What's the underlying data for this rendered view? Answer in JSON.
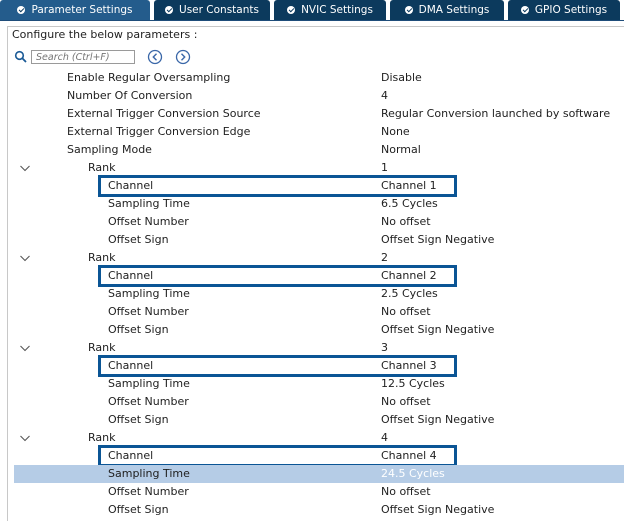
{
  "tabs": [
    {
      "label": "Parameter Settings",
      "active": true
    },
    {
      "label": "User Constants",
      "active": false
    },
    {
      "label": "NVIC Settings",
      "active": false
    },
    {
      "label": "DMA Settings",
      "active": false
    },
    {
      "label": "GPIO Settings",
      "active": false
    }
  ],
  "configure_text": "Configure the below parameters :",
  "search": {
    "placeholder": "Search (Ctrl+F)"
  },
  "colors": {
    "tab_bg": "#0c3a5d",
    "tab_active": "#245c8c",
    "highlight": "#0b5595",
    "selected_row": "#b5cce6"
  },
  "params": [
    {
      "name": "Enable Regular Oversampling",
      "value": "Disable"
    },
    {
      "name": "Number Of Conversion",
      "value": "4"
    },
    {
      "name": "External Trigger Conversion Source",
      "value": "Regular Conversion launched by software"
    },
    {
      "name": "External Trigger Conversion Edge",
      "value": "None"
    },
    {
      "name": "Sampling Mode",
      "value": "Normal"
    }
  ],
  "ranks": [
    {
      "label": "Rank",
      "value": "1",
      "channel": {
        "name": "Channel",
        "value": "Channel 1"
      },
      "sampling_time": {
        "name": "Sampling Time",
        "value": "6.5 Cycles"
      },
      "offset_number": {
        "name": "Offset Number",
        "value": "No offset"
      },
      "offset_sign": {
        "name": "Offset Sign",
        "value": "Offset Sign Negative"
      }
    },
    {
      "label": "Rank",
      "value": "2",
      "channel": {
        "name": "Channel",
        "value": "Channel 2"
      },
      "sampling_time": {
        "name": "Sampling Time",
        "value": "2.5 Cycles"
      },
      "offset_number": {
        "name": "Offset Number",
        "value": "No offset"
      },
      "offset_sign": {
        "name": "Offset Sign",
        "value": "Offset Sign Negative"
      }
    },
    {
      "label": "Rank",
      "value": "3",
      "channel": {
        "name": "Channel",
        "value": "Channel 3"
      },
      "sampling_time": {
        "name": "Sampling Time",
        "value": "12.5 Cycles"
      },
      "offset_number": {
        "name": "Offset Number",
        "value": "No offset"
      },
      "offset_sign": {
        "name": "Offset Sign",
        "value": "Offset Sign Negative"
      }
    },
    {
      "label": "Rank",
      "value": "4",
      "channel": {
        "name": "Channel",
        "value": "Channel 4"
      },
      "sampling_time": {
        "name": "Sampling Time",
        "value": "24.5 Cycles",
        "selected": true
      },
      "offset_number": {
        "name": "Offset Number",
        "value": "No offset"
      },
      "offset_sign": {
        "name": "Offset Sign",
        "value": "Offset Sign Negative"
      }
    }
  ]
}
